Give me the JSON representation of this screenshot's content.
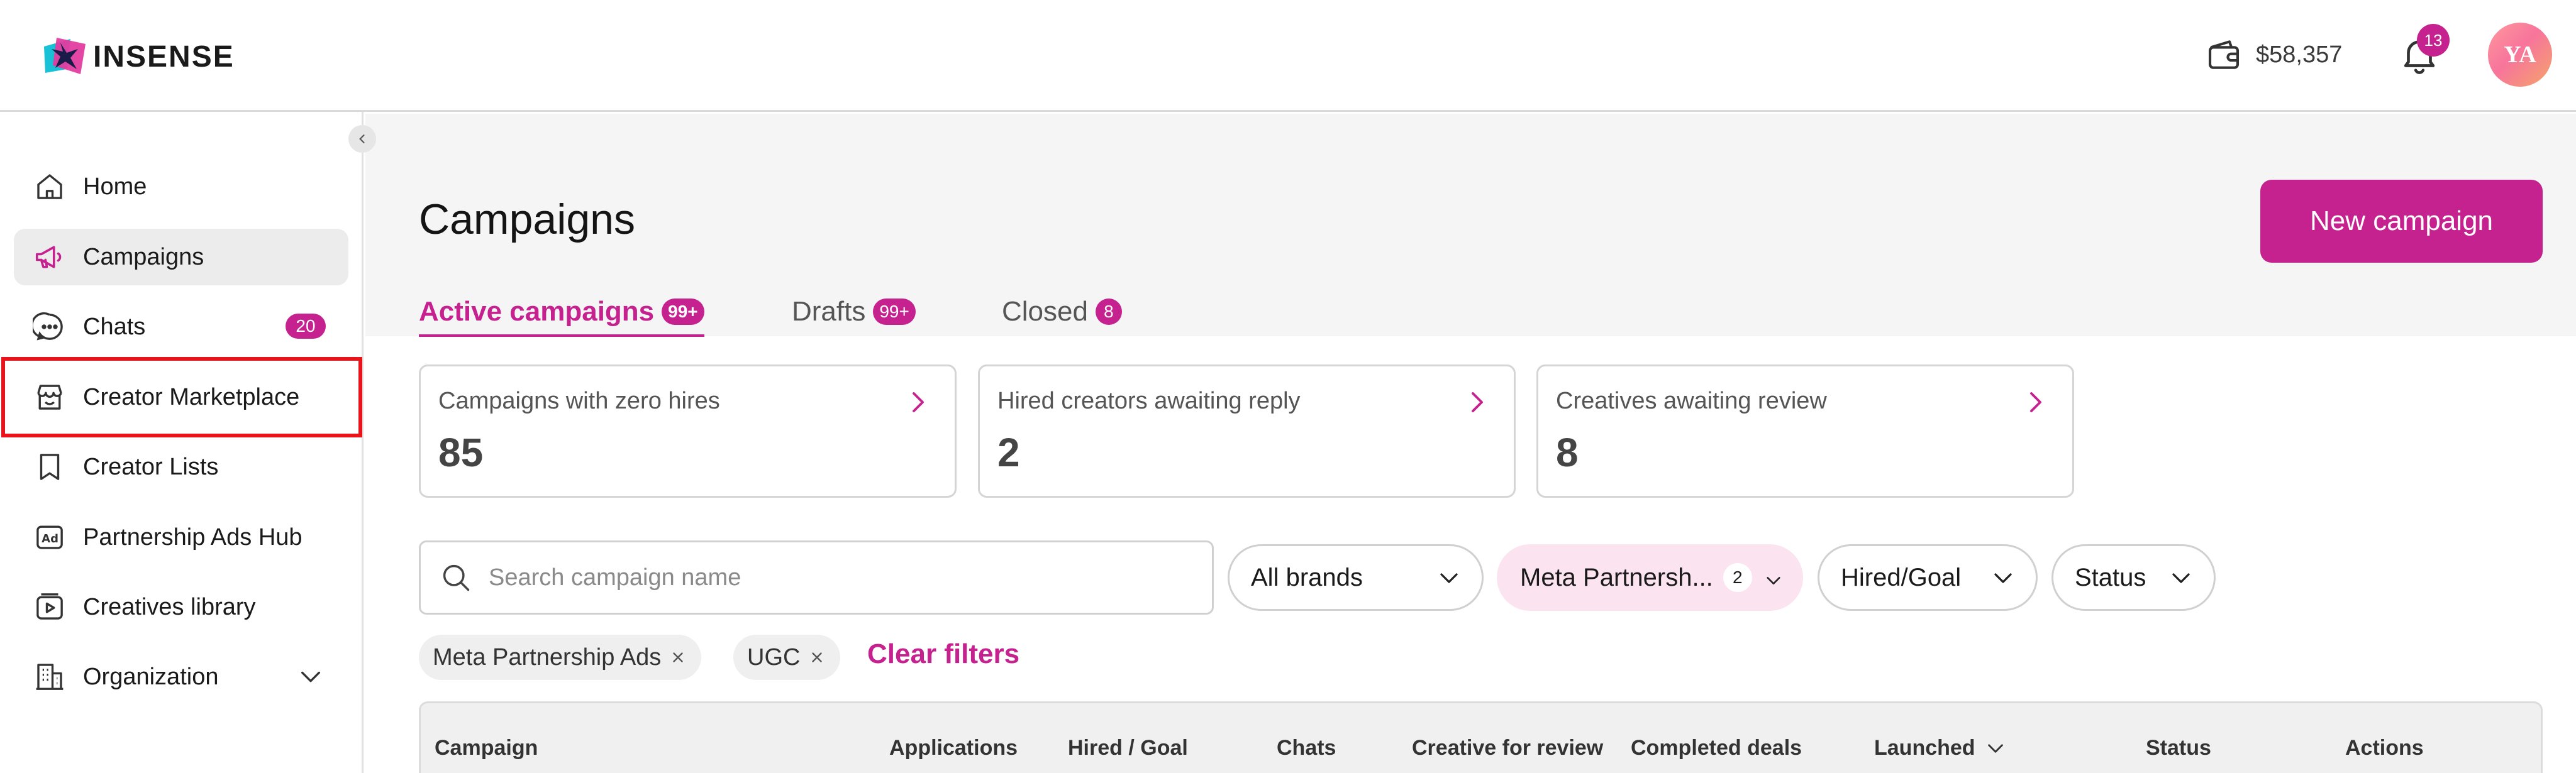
{
  "header": {
    "brand": "INSENSE",
    "wallet_amount": "$58,357",
    "notifications_count": "13",
    "avatar_initials": "YA"
  },
  "sidebar": {
    "items": [
      {
        "label": "Home",
        "icon": "home-icon"
      },
      {
        "label": "Campaigns",
        "icon": "megaphone-icon",
        "active": true
      },
      {
        "label": "Chats",
        "icon": "chat-icon",
        "badge": "20"
      },
      {
        "label": "Creator Marketplace",
        "icon": "store-icon",
        "highlighted": true
      },
      {
        "label": "Creator Lists",
        "icon": "bookmark-icon"
      },
      {
        "label": "Partnership Ads Hub",
        "icon": "ad-icon"
      },
      {
        "label": "Creatives library",
        "icon": "video-library-icon"
      },
      {
        "label": "Organization",
        "icon": "building-icon",
        "expandable": true
      }
    ]
  },
  "main": {
    "title": "Campaigns",
    "new_campaign_label": "New campaign",
    "tabs": [
      {
        "label": "Active campaigns",
        "count": "99+",
        "active": true
      },
      {
        "label": "Drafts",
        "count": "99+"
      },
      {
        "label": "Closed",
        "count": "8"
      }
    ],
    "cards": [
      {
        "label": "Campaigns with zero hires",
        "value": "85"
      },
      {
        "label": "Hired creators awaiting reply",
        "value": "2"
      },
      {
        "label": "Creatives awaiting review",
        "value": "8"
      }
    ],
    "search": {
      "placeholder": "Search campaign name",
      "value": ""
    },
    "filters": {
      "brands": "All brands",
      "meta": "Meta Partnersh...",
      "meta_count": "2",
      "hired_goal": "Hired/Goal",
      "status": "Status"
    },
    "active_filters": [
      "Meta Partnership Ads",
      "UGC"
    ],
    "clear_filters_label": "Clear filters",
    "table_headers": [
      "Campaign",
      "Applications",
      "Hired / Goal",
      "Chats",
      "Creative for review",
      "Completed deals",
      "Launched",
      "Status",
      "Actions"
    ]
  },
  "colors": {
    "accent": "#c5218f",
    "highlight_border": "#e8141b",
    "meta_filter_bg": "#fbe3f0"
  }
}
